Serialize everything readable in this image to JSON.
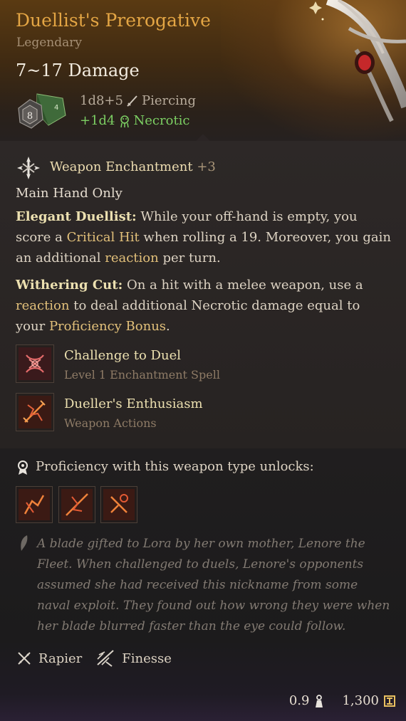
{
  "item": {
    "name": "Duellist's Prerogative",
    "rarity": "Legendary",
    "damage": "7~17 Damage",
    "die_value": "8",
    "damage_line1": "1d8+5",
    "damage_type1": "Piercing",
    "damage_line2": "+1d4",
    "damage_type2": "Necrotic"
  },
  "enchantment": {
    "label": "Weapon Enchantment",
    "bonus": "+3"
  },
  "main_hand": "Main Hand Only",
  "passive1": {
    "name": "Elegant Duellist:",
    "text_a": " While your off-hand is empty, you score a ",
    "hl_a": "Critical Hit",
    "text_b": " when rolling a 19. Moreover, you gain an additional ",
    "hl_b": "reaction",
    "text_c": " per turn."
  },
  "passive2": {
    "name": "Withering Cut:",
    "text_a": " On a hit with a melee weapon, use a ",
    "hl_a": "reaction",
    "text_b": " to deal additional Necrotic damage equal to your ",
    "hl_b": "Proficiency Bonus",
    "text_c": "."
  },
  "actions": [
    {
      "name": "Challenge to Duel",
      "sub": "Level 1 Enchantment Spell",
      "icon": "challenge-to-duel-icon"
    },
    {
      "name": "Dueller's Enthusiasm",
      "sub": "Weapon Actions",
      "icon": "duellers-enthusiasm-icon"
    }
  ],
  "proficiency_label": "Proficiency with this weapon type unlocks:",
  "proficiency_icons": [
    "weapon-action-1-icon",
    "weapon-action-2-icon",
    "weapon-action-3-icon"
  ],
  "lore": "A blade gifted to Lora by her own mother, Lenore the Fleet. When challenged to duels, Lenore's opponents assumed she had received this nickname from some naval exploit. They found out how wrong they were when her blade blurred faster than the eye could follow.",
  "properties": [
    {
      "label": "Rapier",
      "icon": "rapier-icon"
    },
    {
      "label": "Finesse",
      "icon": "finesse-icon"
    }
  ],
  "footer": {
    "weight": "0.9",
    "value": "1,300"
  },
  "colors": {
    "title": "#e3a544",
    "necrotic": "#7ccf63",
    "keyword": "#e2c07a",
    "icon_red": "#e05a4a"
  }
}
